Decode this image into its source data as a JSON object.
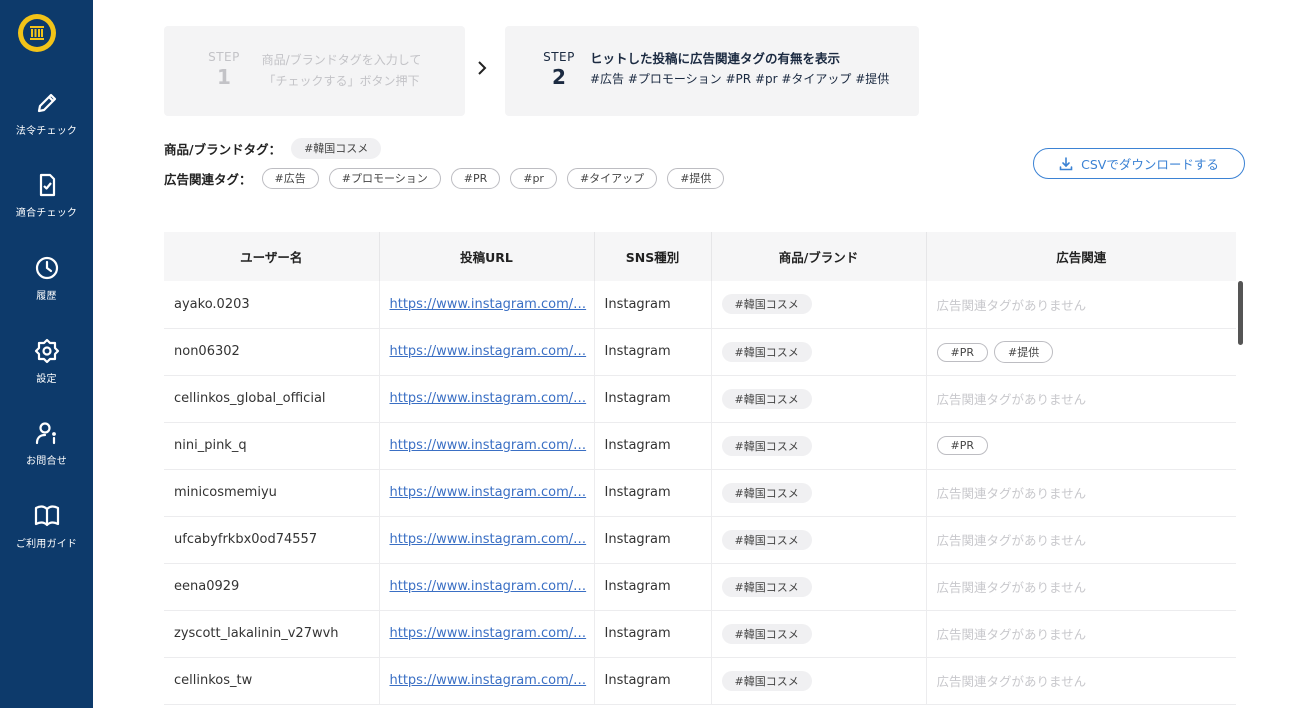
{
  "sidebar": {
    "items": [
      {
        "label": "法令チェック",
        "icon": "pencil-icon"
      },
      {
        "label": "適合チェック",
        "icon": "document-check-icon"
      },
      {
        "label": "履歴",
        "icon": "history-icon"
      },
      {
        "label": "設定",
        "icon": "gear-icon"
      },
      {
        "label": "お問合せ",
        "icon": "user-info-icon"
      },
      {
        "label": "ご利用ガイド",
        "icon": "book-icon"
      }
    ]
  },
  "steps": {
    "step1": {
      "word": "STEP",
      "number": "1",
      "line1": "商品/ブランドタグを入力して",
      "line2": "「チェックする」ボタン押下"
    },
    "step2": {
      "word": "STEP",
      "number": "2",
      "title": "ヒットした投稿に広告関連タグの有無を表示",
      "tags": "#広告 #プロモーション #PR #pr #タイアップ #提供"
    }
  },
  "filters": {
    "brand_label": "商品/ブランドタグ：",
    "brand_tags": [
      "#韓国コスメ"
    ],
    "ad_label": "広告関連タグ：",
    "ad_tags": [
      "#広告",
      "#プロモーション",
      "#PR",
      "#pr",
      "#タイアップ",
      "#提供"
    ]
  },
  "csv_button": {
    "label": "CSVでダウンロードする"
  },
  "table": {
    "headers": [
      "ユーザー名",
      "投稿URL",
      "SNS種別",
      "商品/ブランド",
      "広告関連"
    ],
    "no_ad_text": "広告関連タグがありません",
    "rows": [
      {
        "user": "ayako.0203",
        "url": "https://www.instagram.com/…",
        "sns": "Instagram",
        "brand": "#韓国コスメ",
        "ads": []
      },
      {
        "user": "non06302",
        "url": "https://www.instagram.com/…",
        "sns": "Instagram",
        "brand": "#韓国コスメ",
        "ads": [
          "#PR",
          "#提供"
        ]
      },
      {
        "user": "cellinkos_global_official",
        "url": "https://www.instagram.com/…",
        "sns": "Instagram",
        "brand": "#韓国コスメ",
        "ads": []
      },
      {
        "user": "nini_pink_q",
        "url": "https://www.instagram.com/…",
        "sns": "Instagram",
        "brand": "#韓国コスメ",
        "ads": [
          "#PR"
        ]
      },
      {
        "user": "minicosmemiyu",
        "url": "https://www.instagram.com/…",
        "sns": "Instagram",
        "brand": "#韓国コスメ",
        "ads": []
      },
      {
        "user": "ufcabyfrkbx0od74557",
        "url": "https://www.instagram.com/…",
        "sns": "Instagram",
        "brand": "#韓国コスメ",
        "ads": []
      },
      {
        "user": "eena0929",
        "url": "https://www.instagram.com/…",
        "sns": "Instagram",
        "brand": "#韓国コスメ",
        "ads": []
      },
      {
        "user": "zyscott_lakalinin_v27wvh",
        "url": "https://www.instagram.com/…",
        "sns": "Instagram",
        "brand": "#韓国コスメ",
        "ads": []
      },
      {
        "user": "cellinkos_tw",
        "url": "https://www.instagram.com/…",
        "sns": "Instagram",
        "brand": "#韓国コスメ",
        "ads": []
      }
    ]
  },
  "colors": {
    "sidebar": "#0d3a6b",
    "logo": "#f2c318",
    "accent": "#3b82d4",
    "link": "#3a6fc4"
  }
}
